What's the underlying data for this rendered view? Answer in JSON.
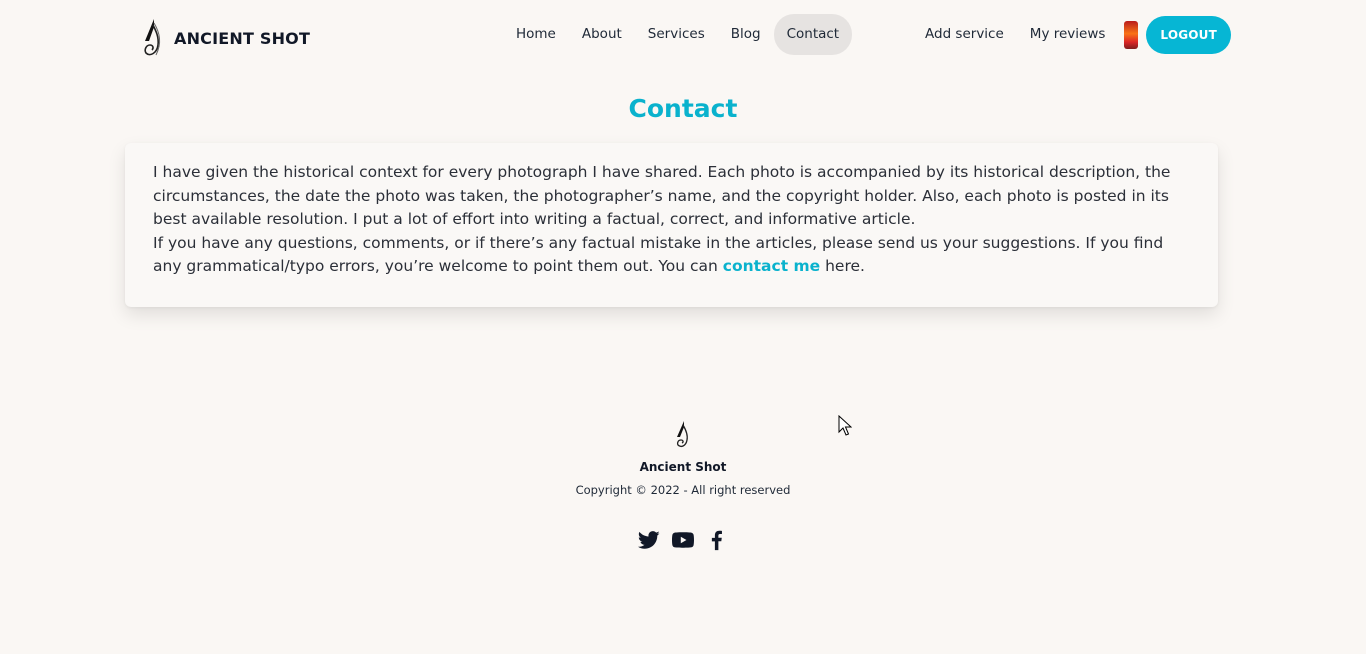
{
  "brand": {
    "name": "ANCIENT SHOT",
    "logo_icon": "brand-logo-icon"
  },
  "nav": {
    "items": [
      {
        "label": "Home",
        "active": false
      },
      {
        "label": "About",
        "active": false
      },
      {
        "label": "Services",
        "active": false
      },
      {
        "label": "Blog",
        "active": false
      },
      {
        "label": "Contact",
        "active": true
      }
    ],
    "add_service": "Add service",
    "my_reviews": "My reviews",
    "logout": "LOGOUT"
  },
  "main": {
    "title": "Contact",
    "paragraph_1": "I have given the historical context for every photograph I have shared. Each photo is accompanied by its historical description, the circumstances, the date the photo was taken, the photographer’s name, and the copyright holder. Also, each photo is posted in its best available resolution. I put a lot of effort into writing a factual, correct, and informative article.",
    "paragraph_2_before": "If you have any questions, comments, or if there’s any factual mistake in the articles, please send us your suggestions. If you find any grammatical/typo errors, you’re welcome to point them out. You can ",
    "paragraph_2_link": "contact me",
    "paragraph_2_after": " here."
  },
  "footer": {
    "brand": "Ancient Shot",
    "copyright": "Copyright © 2022 - All right reserved",
    "socials": [
      "twitter-icon",
      "youtube-icon",
      "facebook-icon"
    ]
  },
  "colors": {
    "accent": "#06b6d4",
    "background": "#faf7f4",
    "active_nav_bg": "#e6e3e1"
  }
}
